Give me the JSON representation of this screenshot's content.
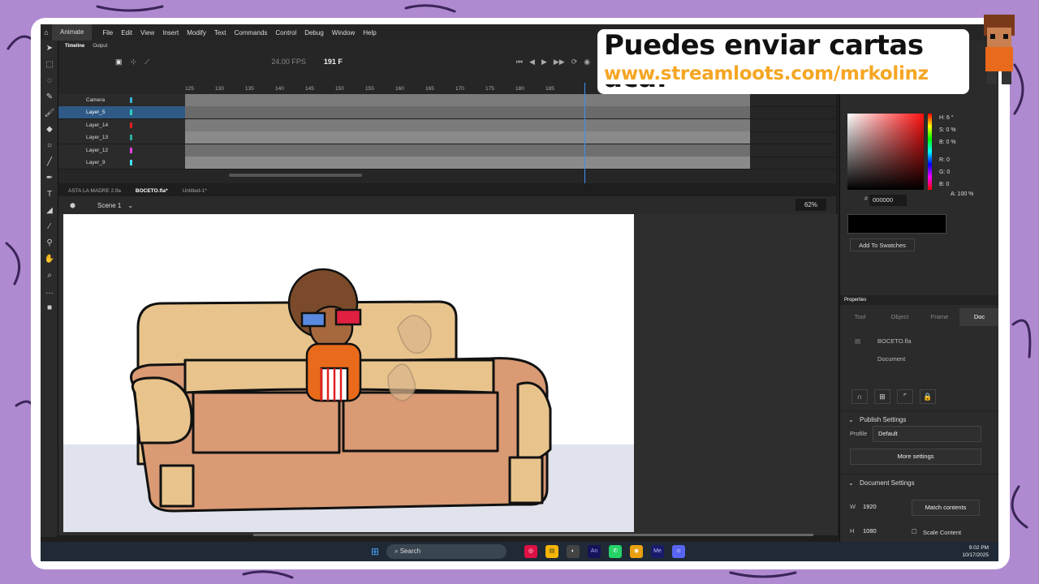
{
  "menubar": {
    "app_label": "Animate",
    "items": [
      "File",
      "Edit",
      "View",
      "Insert",
      "Modify",
      "Text",
      "Commands",
      "Control",
      "Debug",
      "Window",
      "Help"
    ]
  },
  "timeline": {
    "tabs": [
      "Timeline",
      "Output"
    ],
    "fps": "24.00 FPS",
    "current_frame": "191 F",
    "ruler": [
      "125",
      "130",
      "135",
      "140",
      "145",
      "150",
      "155",
      "160",
      "165",
      "170",
      "175",
      "180",
      "185"
    ],
    "layers": [
      {
        "name": "Camera",
        "color": "#35b0d8"
      },
      {
        "name": "Layer_5",
        "color": "#2bd0c0"
      },
      {
        "name": "Layer_14",
        "color": "#e02020"
      },
      {
        "name": "Layer_13",
        "color": "#2bb0a0"
      },
      {
        "name": "Layer_12",
        "color": "#e040e0"
      },
      {
        "name": "Layer_9",
        "color": "#40e0f0"
      }
    ]
  },
  "doc_tabs": [
    "ASTA LA MADRE 2.fla",
    "BOCETO.fla*",
    "Untitled-1*"
  ],
  "scene": {
    "label": "Scene 1",
    "zoom": "62%"
  },
  "color_panel": {
    "h": "H: 6 °",
    "s": "S: 0 %",
    "b": "B: 0 %",
    "r": "R: 0",
    "g": "G: 0",
    "bl": "B: 0",
    "alpha": "A: 100 %",
    "hex": "000000",
    "add_swatches": "Add To Swatches"
  },
  "properties": {
    "header": "Properties",
    "tabs": [
      "Tool",
      "Object",
      "Frame",
      "Doc"
    ],
    "file": "BOCETO.fla",
    "doc_type": "Document",
    "publish_settings": "Publish Settings",
    "profile_label": "Profile",
    "profile_value": "Default",
    "more_settings": "More settings",
    "document_settings": "Document Settings",
    "w_label": "W",
    "w_value": "1920",
    "h_label": "H",
    "h_value": "1080",
    "match_contents": "Match contents",
    "scale_content": "Scale Content"
  },
  "taskbar": {
    "search": "Search",
    "time": "9:02 PM",
    "date": "10/17/2025"
  },
  "overlay": {
    "line1": "Puedes enviar cartas aca:",
    "line2": "www.streamloots.com/mrkolinz"
  },
  "colors": {
    "accent": "#3b8ff5",
    "banner_orange": "#f5a623",
    "background_purple": "#b08ad0"
  }
}
